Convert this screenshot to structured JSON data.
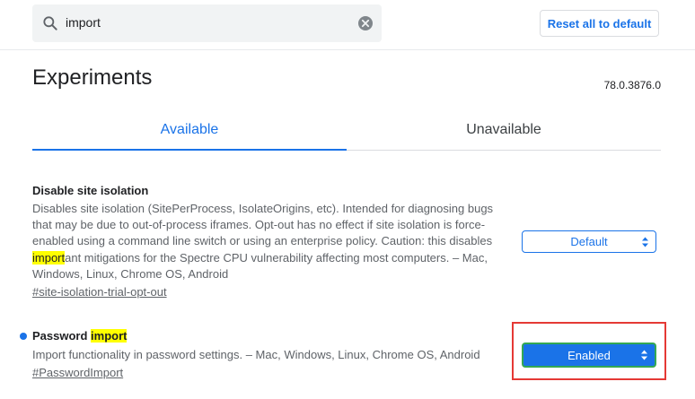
{
  "search": {
    "value": "import"
  },
  "header": {
    "reset_label": "Reset all to default"
  },
  "page": {
    "title": "Experiments",
    "version": "78.0.3876.0"
  },
  "tabs": [
    {
      "label": "Available",
      "active": true
    },
    {
      "label": "Unavailable",
      "active": false
    }
  ],
  "experiments": [
    {
      "title": "Disable site isolation",
      "desc_lines": [
        "Disables site isolation (SitePerProcess, IsolateOrigins, etc). Intended for diagnosing bugs",
        "that may be due to out-of-process iframes. Opt-out has no effect if site isolation is force-",
        "enabled using a command line switch or using an enterprise policy. Caution: this disables"
      ],
      "desc_highlight": "import",
      "desc_after_highlight": "ant mitigations for the Spectre CPU vulnerability affecting most computers. – Mac,",
      "desc_last_line": "Windows, Linux, Chrome OS, Android",
      "link": "#site-isolation-trial-opt-out",
      "select_value": "Default"
    },
    {
      "title_prefix": "Password ",
      "title_highlight": "import",
      "desc": "Import functionality in password settings. – Mac, Windows, Linux, Chrome OS, Android",
      "link": "#PasswordImport",
      "select_value": "Enabled"
    }
  ],
  "colors": {
    "accent": "#1a73e8",
    "highlight": "#ffff00",
    "annotation_box": "#e53935",
    "enabled_outline": "#34a853"
  },
  "icons": [
    "search-icon",
    "clear-icon",
    "select-arrows-icon",
    "modified-dot"
  ]
}
